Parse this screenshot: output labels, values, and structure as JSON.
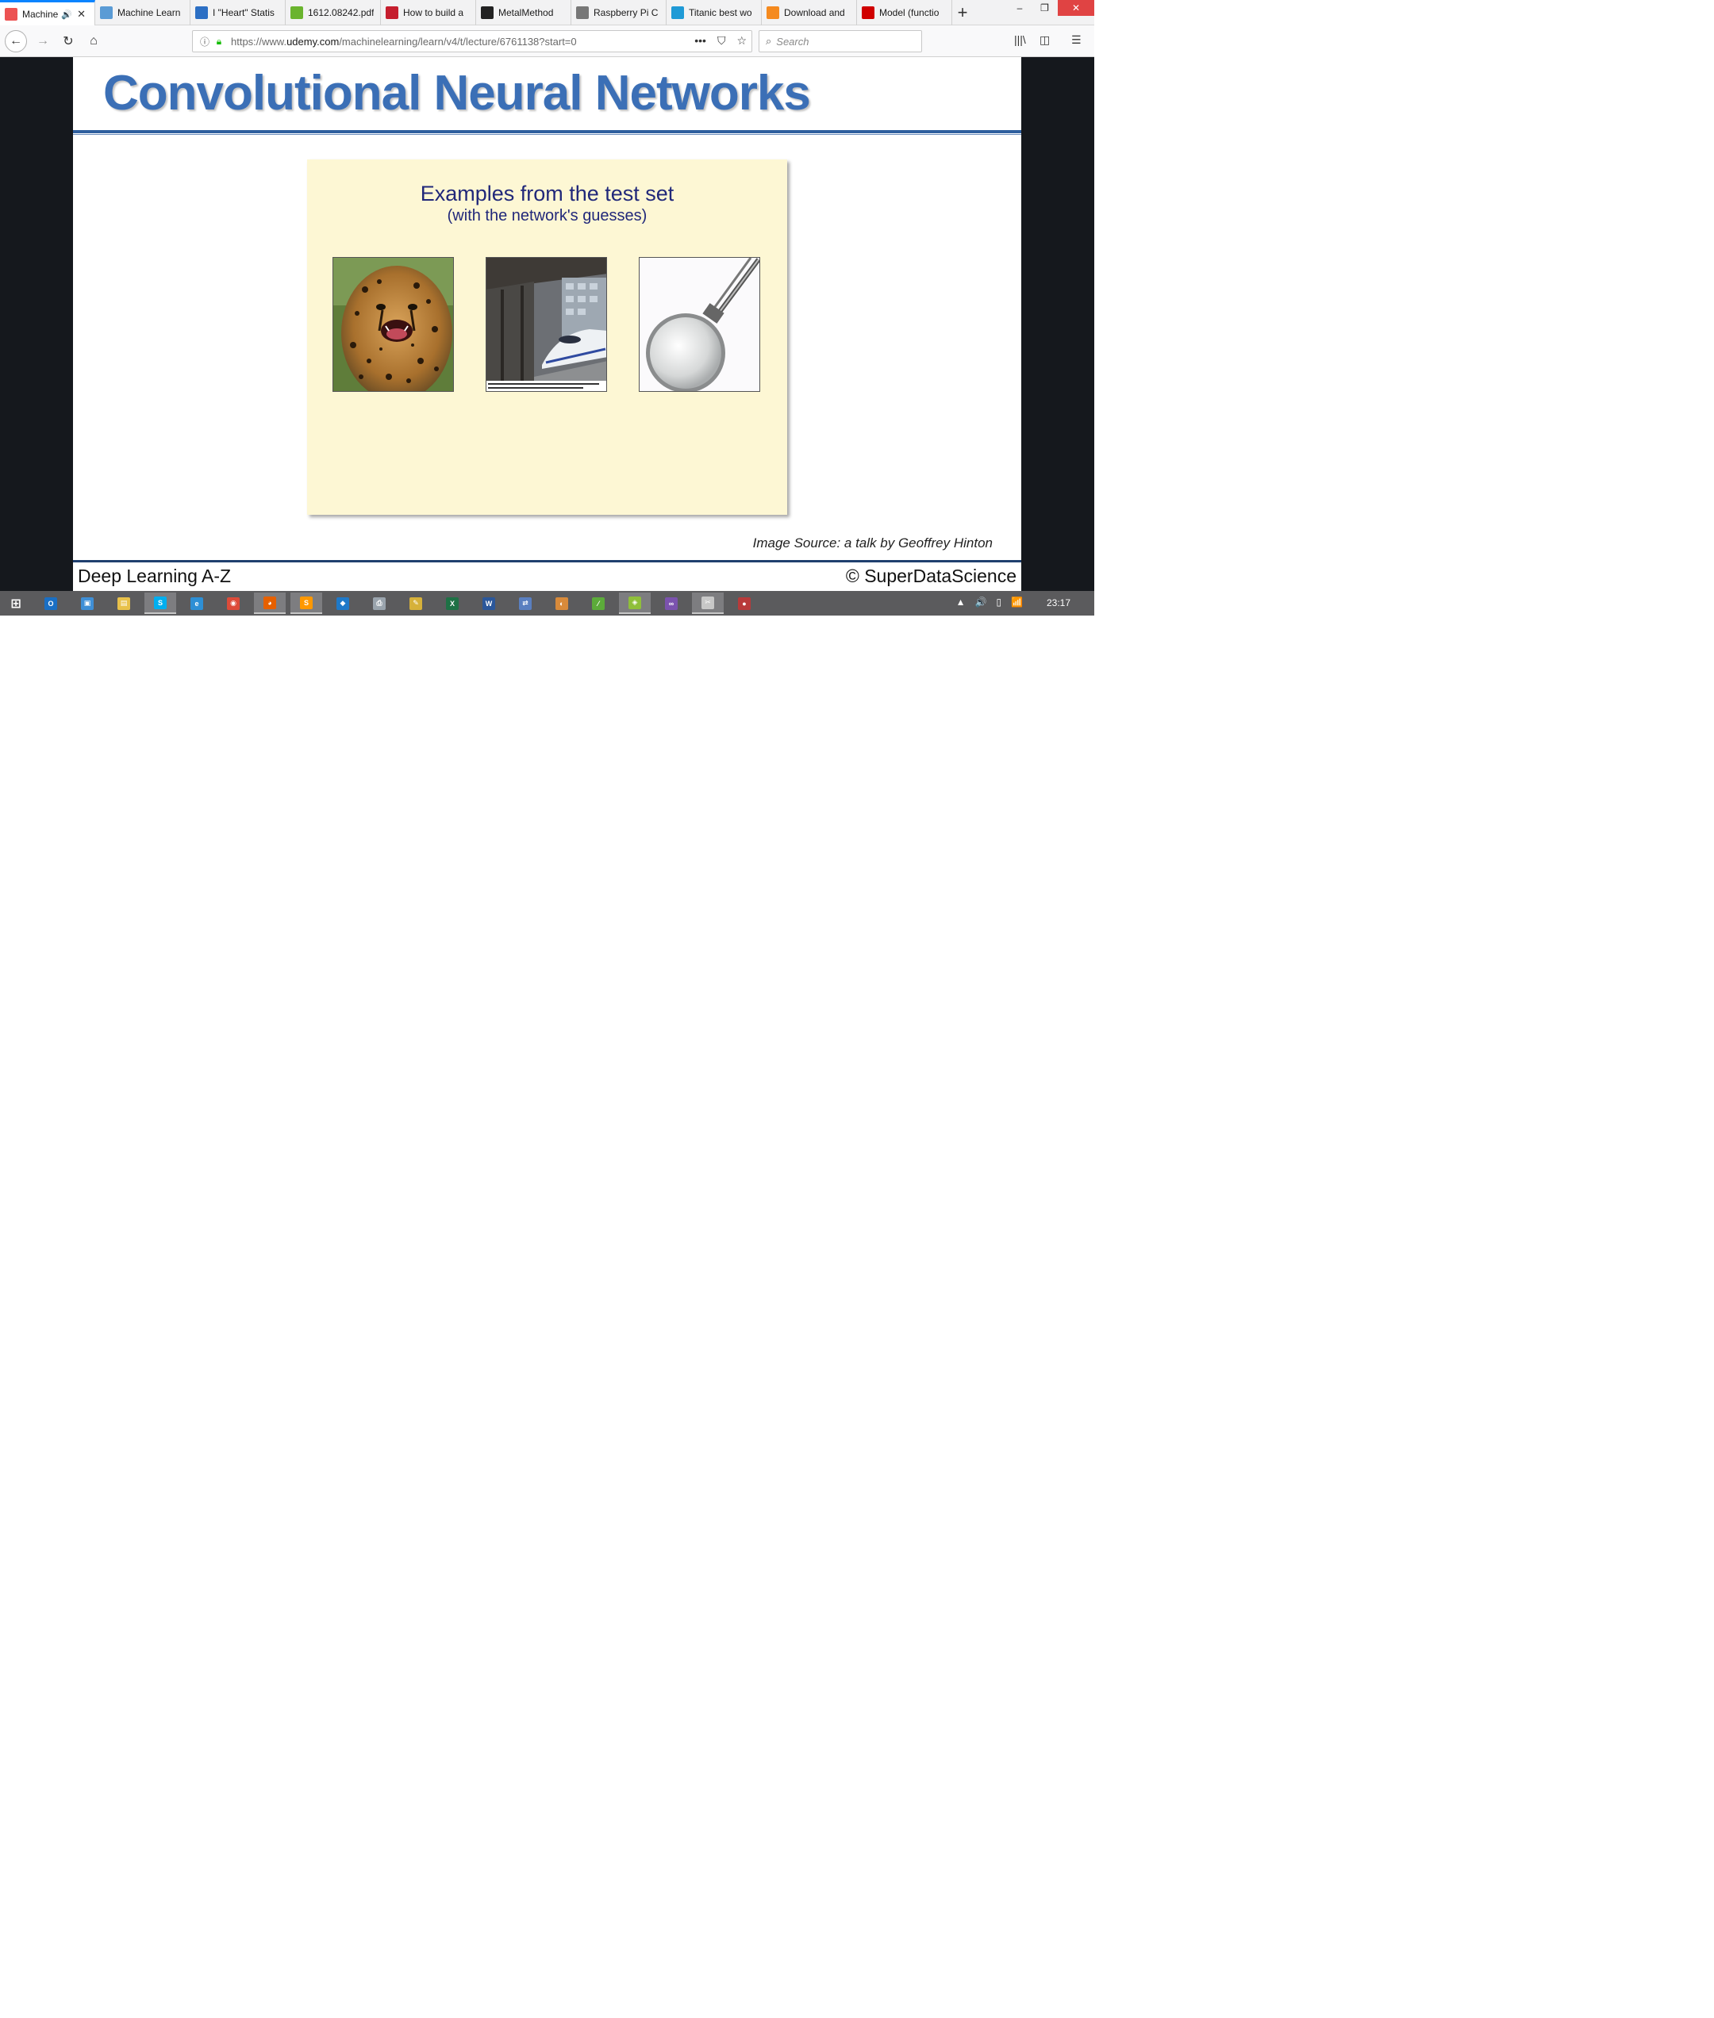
{
  "browser": {
    "tabs": [
      {
        "label": "Machine",
        "icon": "udemy-icon",
        "color": "#ec5252",
        "active": true
      },
      {
        "label": "Machine Learn",
        "icon": "cloud-icon",
        "color": "#5a9bd5"
      },
      {
        "label": "I \"Heart\" Statis",
        "icon": "heart-stats-icon",
        "color": "#2c6fc4"
      },
      {
        "label": "1612.08242.pdf",
        "icon": "pdf-icon",
        "color": "#6ab42e"
      },
      {
        "label": "How to build a",
        "icon": "dt-icon",
        "color": "#c51e2e"
      },
      {
        "label": "MetalMethod",
        "icon": "github-icon",
        "color": "#222222"
      },
      {
        "label": "Raspberry Pi C",
        "icon": "raspberry-icon",
        "color": "#777777"
      },
      {
        "label": "Titanic best wo",
        "icon": "kaggle-icon",
        "color": "#1f9ad6"
      },
      {
        "label": "Download and",
        "icon": "tensorflow-icon",
        "color": "#f58a1f"
      },
      {
        "label": "Model (functio",
        "icon": "keras-icon",
        "color": "#d00000"
      }
    ],
    "new_tab": "+",
    "window_controls": {
      "minimize": "–",
      "maximize": "❐",
      "close": "✕"
    },
    "url_prefix": "https://www.",
    "url_domain": "udemy.com",
    "url_path": "/machinelearning/learn/v4/t/lecture/6761138?start=0",
    "search_placeholder": "Search",
    "url_more": "•••"
  },
  "slide": {
    "title": "Convolutional Neural Networks",
    "panel_title": "Examples from the test set",
    "panel_subtitle": "(with the network's guesses)",
    "image_source": "Image Source: a talk by Geoffrey Hinton",
    "footer_left": "Deep Learning A-Z",
    "footer_right": "© SuperDataScience"
  },
  "taskbar": {
    "clock": "23:17",
    "apps": [
      {
        "icon": "windows-start-icon",
        "color": "#ffffff"
      },
      {
        "icon": "outlook-icon",
        "color": "#1a6fc4"
      },
      {
        "icon": "computer-icon",
        "color": "#3f8fd6"
      },
      {
        "icon": "file-explorer-icon",
        "color": "#e8c14a"
      },
      {
        "icon": "skype-icon",
        "color": "#00aff0"
      },
      {
        "icon": "ie-icon",
        "color": "#2d8fd5"
      },
      {
        "icon": "chrome-icon",
        "color": "#dd4b39"
      },
      {
        "icon": "firefox-icon",
        "color": "#e66000"
      },
      {
        "icon": "sublime-icon",
        "color": "#ff9800"
      },
      {
        "icon": "vscode-icon",
        "color": "#1e79c9"
      },
      {
        "icon": "printer-icon",
        "color": "#9aa4ad"
      },
      {
        "icon": "tools-icon",
        "color": "#d6b13a"
      },
      {
        "icon": "excel-icon",
        "color": "#1e7145"
      },
      {
        "icon": "word-icon",
        "color": "#2b579a"
      },
      {
        "icon": "network-icon",
        "color": "#5a7fc0"
      },
      {
        "icon": "paint-icon",
        "color": "#d88a3a"
      },
      {
        "icon": "pen-icon",
        "color": "#5cab3a"
      },
      {
        "icon": "app-green-icon",
        "color": "#8fbf3a"
      },
      {
        "icon": "visual-studio-icon",
        "color": "#7b52ae"
      },
      {
        "icon": "snipping-icon",
        "color": "#c7c7c7"
      },
      {
        "icon": "record-icon",
        "color": "#b83a3a"
      }
    ],
    "tray": {
      "chevron": "▲",
      "volume": "🔊",
      "battery": "▯",
      "signal": "📶"
    }
  }
}
